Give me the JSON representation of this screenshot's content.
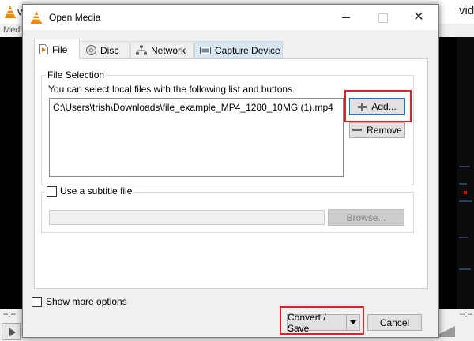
{
  "background_window": {
    "title_left": "v",
    "title_right": "vid",
    "menu_text": "Medi",
    "time_left": "--:--",
    "time_right": "--:--",
    "stripe_color": "#2b3f63",
    "playback_marker_color": "#e00000"
  },
  "dialog": {
    "title": "Open Media",
    "icon": "vlc-cone-icon",
    "window_controls": [
      "minimize",
      "maximize",
      "close"
    ],
    "close_glyph": "✕",
    "tabs": [
      {
        "label": "File",
        "icon": "file-icon",
        "active": true
      },
      {
        "label": "Disc",
        "icon": "disc-icon",
        "active": false
      },
      {
        "label": "Network",
        "icon": "network-icon",
        "active": false
      },
      {
        "label": "Capture Device",
        "icon": "capture-device-icon",
        "active": false
      }
    ],
    "file_selection": {
      "group_label": "File Selection",
      "help_text": "You can select local files with the following list and buttons.",
      "files": [
        "C:\\Users\\trish\\Downloads\\file_example_MP4_1280_10MG (1).mp4"
      ],
      "add_button": "Add...",
      "remove_button": "Remove"
    },
    "subtitle": {
      "checkbox_label": "Use a subtitle file",
      "checked": false,
      "path_value": "",
      "browse_button": "Browse..."
    },
    "show_more_options": {
      "label": "Show more options",
      "checked": false
    },
    "convert_save_button": "Convert / Save",
    "cancel_button": "Cancel",
    "highlight_color": "#d7262b"
  }
}
